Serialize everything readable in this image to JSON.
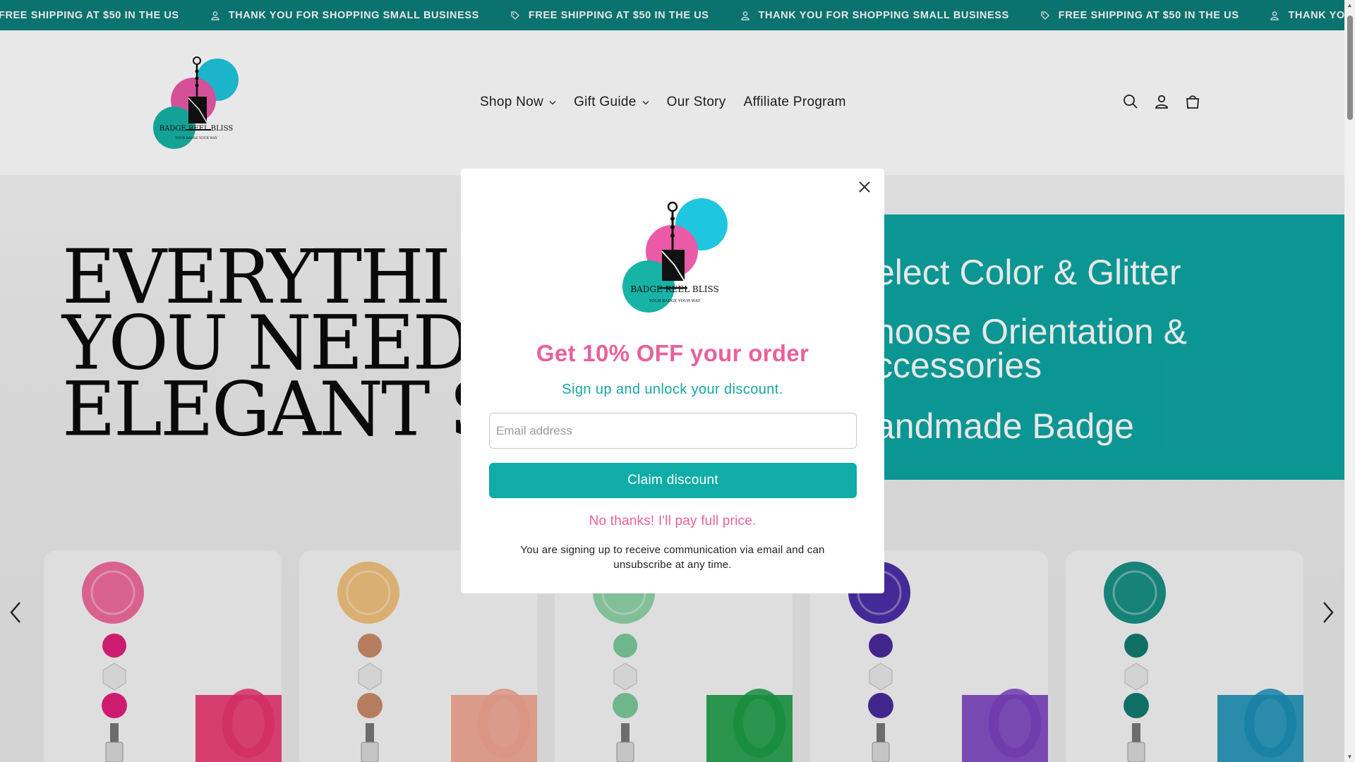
{
  "announcement": {
    "items": [
      {
        "icon": "tag-icon",
        "text": "FREE SHIPPING AT $50 IN THE US"
      },
      {
        "icon": "person-icon",
        "text": "THANK YOU FOR SHOPPING SMALL BUSINESS"
      },
      {
        "icon": "tag-icon",
        "text": "FREE SHIPPING AT $50 IN THE US"
      },
      {
        "icon": "person-icon",
        "text": "THANK YOU FOR SHOPPING SMALL BUSINESS"
      },
      {
        "icon": "tag-icon",
        "text": "FREE SHIPPING AT $50 IN THE US"
      },
      {
        "icon": "person-icon",
        "text": "THANK YOU FOR SHOPPING SMALL BUSINESS"
      }
    ]
  },
  "header": {
    "logo_text": "BADGE REEL BLISS",
    "logo_tagline": "YOUR BADGE YOUR WAY",
    "nav": {
      "shop_now": "Shop Now",
      "gift_guide": "Gift Guide",
      "our_story": "Our Story",
      "affiliate_program": "Affiliate Program"
    },
    "icons": [
      "search-icon",
      "account-icon",
      "cart-icon"
    ]
  },
  "hero": {
    "title_line1": "EVERYTHI",
    "title_line2": "YOU NEED",
    "title_line3": "ELEGANT S",
    "teal_line1": "elect Color & Glitter",
    "teal_line2a": "hoose Orientation &",
    "teal_line2b": "ccessories",
    "teal_line3": "andmade Badge"
  },
  "products": [
    {
      "reel_color": "#ee6b9b",
      "bead_color": "#e21f7c",
      "bg_item_color": "#e8336f"
    },
    {
      "reel_color": "#f0c17e",
      "bead_color": "#c78a68",
      "bg_item_color": "#f0a38e"
    },
    {
      "reel_color": "#8fd2a6",
      "bead_color": "#7bc89b",
      "bg_item_color": "#1a9a44"
    },
    {
      "reel_color": "#4b2fa7",
      "bead_color": "#4a2a9a",
      "bg_item_color": "#7a3fbf"
    },
    {
      "reel_color": "#1a8f83",
      "bead_color": "#127a70",
      "bg_item_color": "#1a8fb5"
    }
  ],
  "popup": {
    "logo_text": "BADGE REEL BLISS",
    "logo_tagline": "YOUR BADGE YOUR WAY",
    "heading": "Get 10% OFF your order",
    "subheading": "Sign up and unlock your discount.",
    "email_placeholder": "Email address",
    "email_value": "",
    "claim_label": "Claim discount",
    "decline_label": "No thanks! I'll pay full price.",
    "fine_print": "You are signing up to receive communication via email and can unsubscribe at any time."
  },
  "colors": {
    "announcement_bg": "#0c7e7a",
    "brand_pink": "#e8609d",
    "brand_teal": "#10aca7",
    "logo_blue": "#1ec6e0",
    "logo_pink": "#ea5aa7",
    "logo_green": "#17b3a6"
  }
}
